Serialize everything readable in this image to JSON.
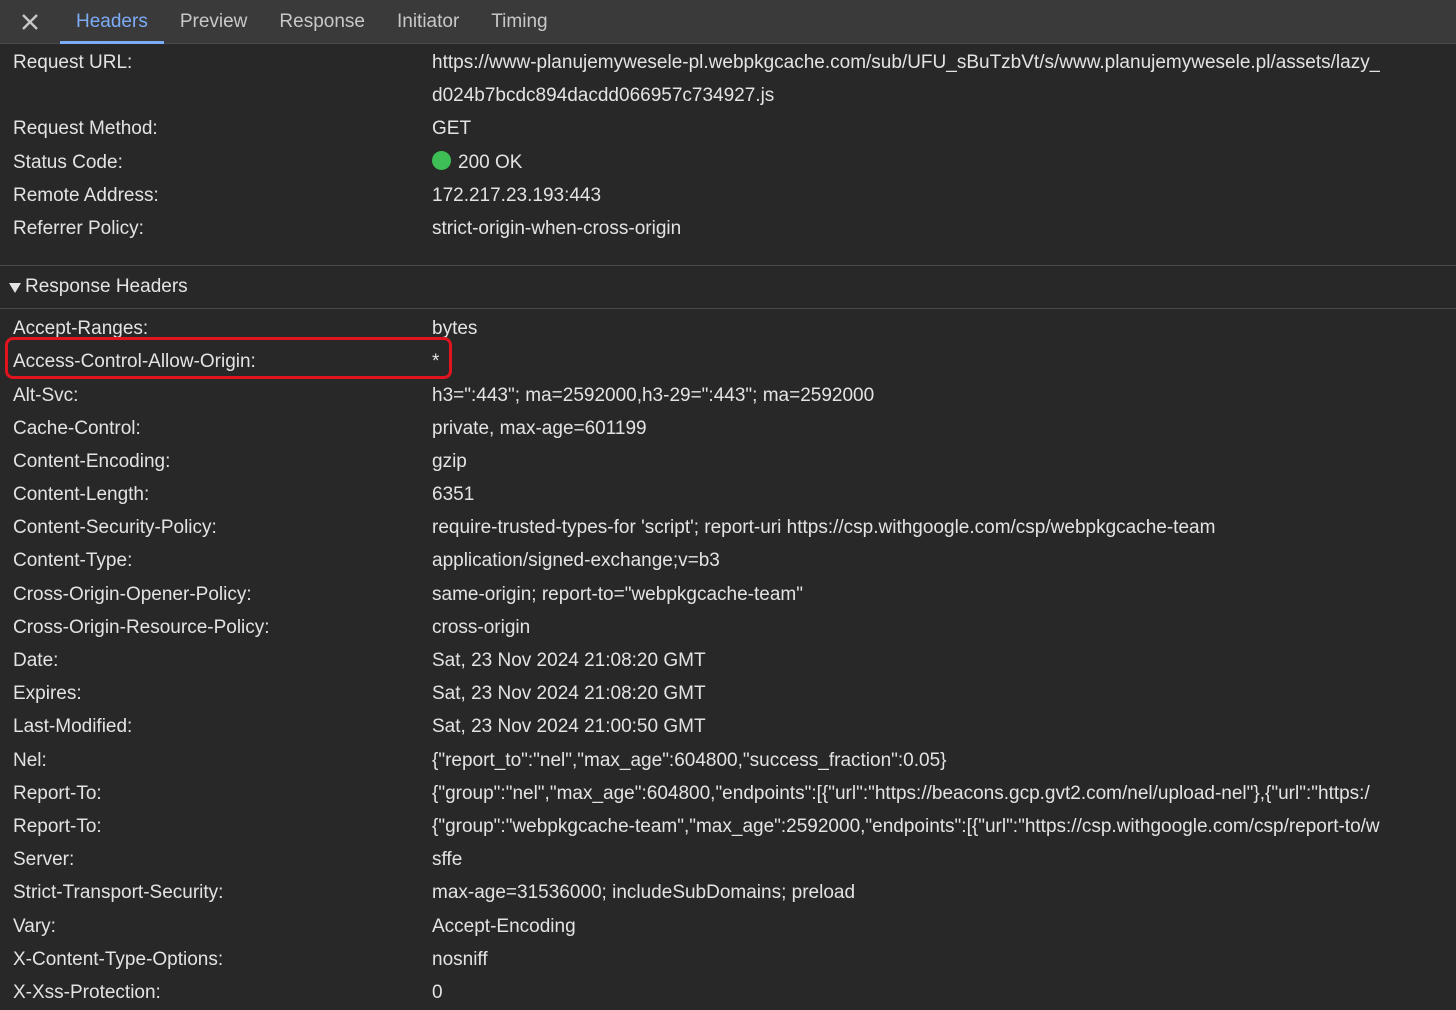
{
  "tabs": [
    {
      "label": "Headers",
      "active": true
    },
    {
      "label": "Preview",
      "active": false
    },
    {
      "label": "Response",
      "active": false
    },
    {
      "label": "Initiator",
      "active": false
    },
    {
      "label": "Timing",
      "active": false
    }
  ],
  "close_icon": "close-icon",
  "general": {
    "request_url": {
      "name": "Request URL:",
      "value_line1": "https://www-planujemywesele-pl.webpkgcache.com/sub/UFU_sBuTzbVt/s/www.planujemywesele.pl/assets/lazy_",
      "value_line2": "d024b7bcdc894dacdd066957c734927.js"
    },
    "request_method": {
      "name": "Request Method:",
      "value": "GET"
    },
    "status_code": {
      "name": "Status Code:",
      "value": "200 OK",
      "status_color": "#3ebf55"
    },
    "remote_address": {
      "name": "Remote Address:",
      "value": "172.217.23.193:443"
    },
    "referrer_policy": {
      "name": "Referrer Policy:",
      "value": "strict-origin-when-cross-origin"
    }
  },
  "response_headers": {
    "title": "Response Headers",
    "expanded": true,
    "highlight_color": "#e0141e",
    "rows": [
      {
        "name": "Accept-Ranges:",
        "value": "bytes"
      },
      {
        "name": "Access-Control-Allow-Origin:",
        "value": "*"
      },
      {
        "name": "Alt-Svc:",
        "value": "h3=\":443\"; ma=2592000,h3-29=\":443\"; ma=2592000"
      },
      {
        "name": "Cache-Control:",
        "value": "private, max-age=601199"
      },
      {
        "name": "Content-Encoding:",
        "value": "gzip"
      },
      {
        "name": "Content-Length:",
        "value": "6351"
      },
      {
        "name": "Content-Security-Policy:",
        "value": "require-trusted-types-for 'script'; report-uri https://csp.withgoogle.com/csp/webpkgcache-team"
      },
      {
        "name": "Content-Type:",
        "value": "application/signed-exchange;v=b3"
      },
      {
        "name": "Cross-Origin-Opener-Policy:",
        "value": "same-origin; report-to=\"webpkgcache-team\""
      },
      {
        "name": "Cross-Origin-Resource-Policy:",
        "value": "cross-origin"
      },
      {
        "name": "Date:",
        "value": "Sat, 23 Nov 2024 21:08:20 GMT"
      },
      {
        "name": "Expires:",
        "value": "Sat, 23 Nov 2024 21:08:20 GMT"
      },
      {
        "name": "Last-Modified:",
        "value": "Sat, 23 Nov 2024 21:00:50 GMT"
      },
      {
        "name": "Nel:",
        "value": "{\"report_to\":\"nel\",\"max_age\":604800,\"success_fraction\":0.05}"
      },
      {
        "name": "Report-To:",
        "value": "{\"group\":\"nel\",\"max_age\":604800,\"endpoints\":[{\"url\":\"https://beacons.gcp.gvt2.com/nel/upload-nel\"},{\"url\":\"https:/"
      },
      {
        "name": "Report-To:",
        "value": "{\"group\":\"webpkgcache-team\",\"max_age\":2592000,\"endpoints\":[{\"url\":\"https://csp.withgoogle.com/csp/report-to/w"
      },
      {
        "name": "Server:",
        "value": "sffe"
      },
      {
        "name": "Strict-Transport-Security:",
        "value": "max-age=31536000; includeSubDomains; preload"
      },
      {
        "name": "Vary:",
        "value": "Accept-Encoding"
      },
      {
        "name": "X-Content-Type-Options:",
        "value": "nosniff"
      },
      {
        "name": "X-Xss-Protection:",
        "value": "0"
      }
    ]
  }
}
